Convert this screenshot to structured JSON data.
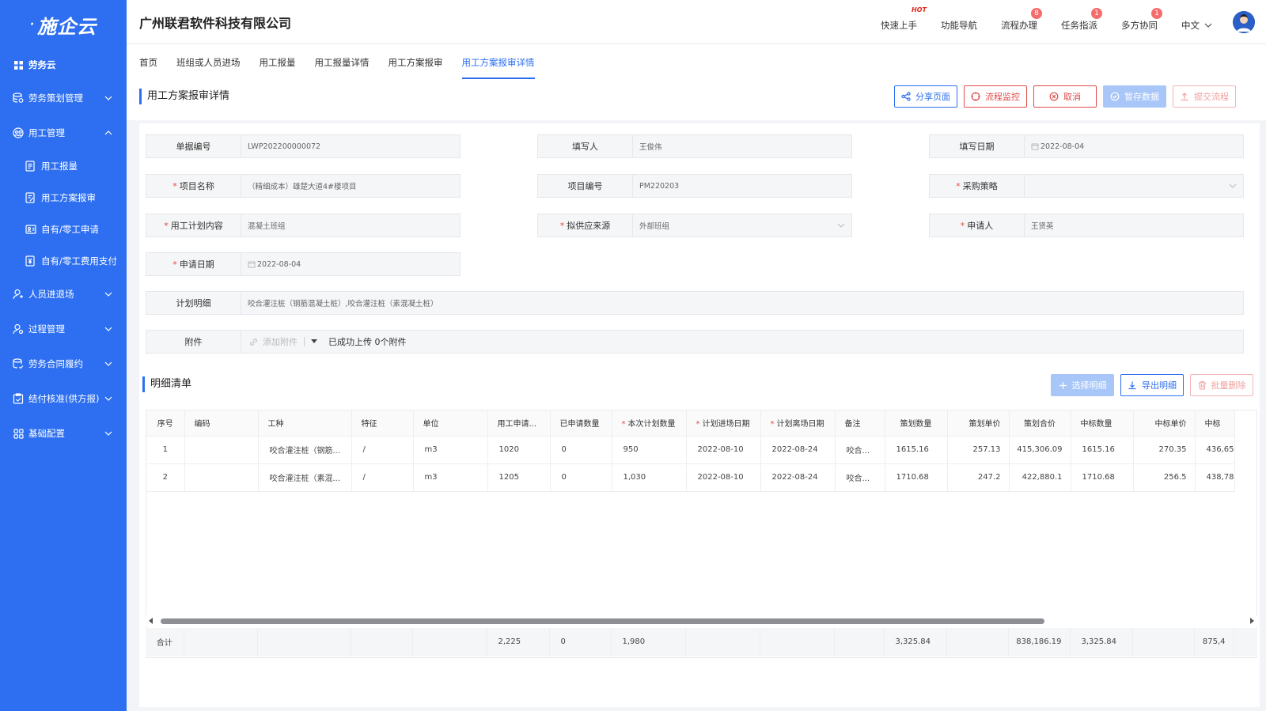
{
  "sidebar": {
    "logo": "施企云",
    "items": [
      {
        "label": "劳务云",
        "icon": "grid-icon"
      },
      {
        "label": "劳务策划管理",
        "icon": "database-icon"
      },
      {
        "label": "用工管理",
        "icon": "people-icon"
      },
      {
        "label": "人员进退场",
        "icon": "person-icon"
      },
      {
        "label": "过程管理",
        "icon": "person-gear-icon"
      },
      {
        "label": "劳务合同履约",
        "icon": "contract-icon"
      },
      {
        "label": "结付核准(供方报)",
        "icon": "clipboard-check-icon"
      },
      {
        "label": "基础配置",
        "icon": "apps-icon"
      }
    ],
    "subitems": [
      {
        "label": "用工报量"
      },
      {
        "label": "用工方案报审"
      },
      {
        "label": "自有/零工申请"
      },
      {
        "label": "自有/零工费用支付"
      }
    ]
  },
  "header": {
    "company": "广州联君软件科技有限公司",
    "links": [
      {
        "label": "快速上手",
        "badge": "HOT"
      },
      {
        "label": "功能导航",
        "badge": ""
      },
      {
        "label": "流程办理",
        "badge": "8"
      },
      {
        "label": "任务指派",
        "badge": "1"
      },
      {
        "label": "多方协同",
        "badge": "1"
      }
    ],
    "language": "中文"
  },
  "tabs": [
    {
      "label": "首页"
    },
    {
      "label": "班组或人员进场"
    },
    {
      "label": "用工报量"
    },
    {
      "label": "用工报量详情"
    },
    {
      "label": "用工方案报审"
    },
    {
      "label": "用工方案报审详情"
    }
  ],
  "page": {
    "title": "用工方案报审详情",
    "actions": {
      "share": "分享页面",
      "monitor": "流程监控",
      "cancel": "取消",
      "save": "暂存数据",
      "submit": "提交流程"
    }
  },
  "form": {
    "doc_no_label": "单据编号",
    "doc_no": "LWP202200000072",
    "filler_label": "填写人",
    "filler": "王俊伟",
    "fill_date_label": "填写日期",
    "fill_date": "2022-08-04",
    "project_name_label": "项目名称",
    "project_name": "（精细成本）雄楚大道4#楼项目",
    "project_no_label": "项目编号",
    "project_no": "PM220203",
    "strategy_label": "采购策略",
    "strategy": "",
    "plan_content_label": "用工计划内容",
    "plan_content": "混凝土班组",
    "source_label": "拟供应来源",
    "source": "外部班组",
    "applicant_label": "申请人",
    "applicant": "王贤英",
    "apply_date_label": "申请日期",
    "apply_date": "2022-08-04",
    "plan_detail_label": "计划明细",
    "plan_detail": "咬合灌注桩（钢筋混凝土桩）,咬合灌注桩（素混凝土桩）",
    "attach_label": "附件",
    "attach_add": "添加附件",
    "attach_status": "已成功上传 0个附件"
  },
  "detail": {
    "title": "明细清单",
    "select_btn": "选择明细",
    "export_btn": "导出明细",
    "delete_btn": "批量删除",
    "columns": [
      "序号",
      "编码",
      "工种",
      "特征",
      "单位",
      "用工申请...",
      "已申请数量",
      "本次计划数量",
      "计划进场日期",
      "计划离场日期",
      "备注",
      "策划数量",
      "策划单价",
      "策划合价",
      "中标数量",
      "中标单价",
      "中标"
    ],
    "rows": [
      [
        "1",
        "",
        "咬合灌注桩（钢筋...",
        "/",
        "m3",
        "1020",
        "0",
        "950",
        "2022-08-10",
        "2022-08-24",
        "咬合...",
        "1615.16",
        "257.13",
        "415,306.09",
        "1615.16",
        "270.35",
        "436,65"
      ],
      [
        "2",
        "",
        "咬合灌注桩（素混...",
        "/",
        "m3",
        "1205",
        "0",
        "1,030",
        "2022-08-10",
        "2022-08-24",
        "咬合...",
        "1710.68",
        "247.2",
        "422,880.1",
        "1710.68",
        "256.5",
        "438,78"
      ]
    ],
    "totals": [
      "合计",
      "",
      "",
      "",
      "",
      "2,225",
      "0",
      "1,980",
      "",
      "",
      "",
      "3,325.84",
      "",
      "838,186.19",
      "3,325.84",
      "",
      "875,4"
    ]
  },
  "colors": {
    "primary": "#2d6ff0",
    "danger": "#e04a4a",
    "badge": "#f56c6c"
  }
}
